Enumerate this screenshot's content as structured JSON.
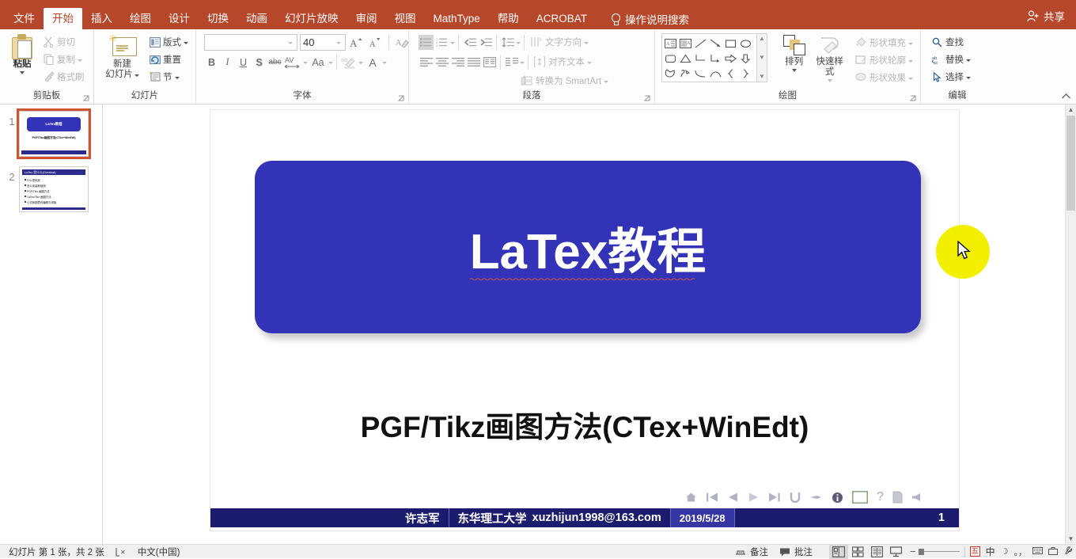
{
  "titlebar": {
    "tabs": [
      {
        "label": "文件",
        "active": false
      },
      {
        "label": "开始",
        "active": true
      },
      {
        "label": "插入",
        "active": false
      },
      {
        "label": "绘图",
        "active": false
      },
      {
        "label": "设计",
        "active": false
      },
      {
        "label": "切换",
        "active": false
      },
      {
        "label": "动画",
        "active": false
      },
      {
        "label": "幻灯片放映",
        "active": false
      },
      {
        "label": "审阅",
        "active": false
      },
      {
        "label": "视图",
        "active": false
      },
      {
        "label": "MathType",
        "active": false
      },
      {
        "label": "帮助",
        "active": false
      },
      {
        "label": "ACROBAT",
        "active": false
      }
    ],
    "tell_me": "操作说明搜索",
    "share": "共享",
    "accent_color": "#b7472a"
  },
  "ribbon": {
    "groups": [
      {
        "name": "clipboard",
        "title": "剪贴板"
      },
      {
        "name": "slides",
        "title": "幻灯片"
      },
      {
        "name": "font",
        "title": "字体"
      },
      {
        "name": "paragraph",
        "title": "段落"
      },
      {
        "name": "drawing",
        "title": "绘图"
      },
      {
        "name": "editing",
        "title": "编辑"
      }
    ],
    "clipboard": {
      "paste": "粘贴",
      "cut": "剪切",
      "copy": "复制",
      "format_painter": "格式刷"
    },
    "slides": {
      "new_slide": "新建\n幻灯片",
      "new_slide_line1": "新建",
      "new_slide_line2": "幻灯片",
      "layout": "版式",
      "reset": "重置",
      "section": "节"
    },
    "font": {
      "font_name_value": "",
      "font_name_placeholder": "",
      "font_size_value": "40",
      "grow_font": "A",
      "shrink_font": "A",
      "clear_formatting": "清除所有格式",
      "bold": "B",
      "italic": "I",
      "underline": "U",
      "shadow": "S",
      "strikethrough": "abc",
      "char_spacing": "AV",
      "change_case": "Aa",
      "highlight": "ab",
      "font_color": "A"
    },
    "paragraph": {
      "text_direction": "文字方向",
      "align_text": "对齐文本",
      "convert_smartart": "转换为 SmartArt"
    },
    "drawing": {
      "arrange": "排列",
      "quick_styles_line1": "快速样式",
      "shape_fill": "形状填充",
      "shape_outline": "形状轮廓",
      "shape_effects": "形状效果"
    },
    "editing": {
      "find": "查找",
      "replace": "替换",
      "select": "选择",
      "replace_icon_text": "ab\nac"
    }
  },
  "thumbnails": {
    "slides": [
      {
        "number": "1",
        "selected": true,
        "title": "LaTex教程",
        "subtitle": "PGF/Tikz画图方法(CTex+WinEdt)"
      },
      {
        "number": "2",
        "selected": false,
        "header": "LaTex 是什么(Overleaf)",
        "bullets": [
          "什么是乳胶",
          "怎么安装和使用",
          "PGF/Tikz 画图方法",
          "LaTex/Tikz 画图方法",
          "公式和图表的编辑与排版"
        ]
      }
    ]
  },
  "slide": {
    "title": "LaTex教程",
    "title_latin": "LaTex",
    "title_cjk": "教程",
    "title_bg_color": "#3333b8",
    "subtitle": "PGF/Tikz画图方法(CTex+WinEdt)",
    "nav_icons": [
      "home-icon",
      "first-slide-icon",
      "prev-slide-icon",
      "play-icon",
      "next-slide-icon",
      "back-icon",
      "pointer-icon",
      "info-icon",
      "frame-icon",
      "help-icon",
      "doc-icon",
      "sound-icon"
    ],
    "footer": {
      "author": "许志军",
      "affiliation": "东华理工大学",
      "email": "xuzhijun1998@163.com",
      "date": "2019/5/28",
      "page": "1"
    }
  },
  "statusbar": {
    "slide_counter": "幻灯片 第 1 张，共 2 张",
    "language": "中文(中国)",
    "notes": "备注",
    "comments": "批注",
    "views": [
      "normal-view",
      "slide-sorter-view",
      "reading-view",
      "slideshow-view"
    ],
    "ime": {
      "mode_box": "五",
      "mode_label": "中"
    }
  }
}
